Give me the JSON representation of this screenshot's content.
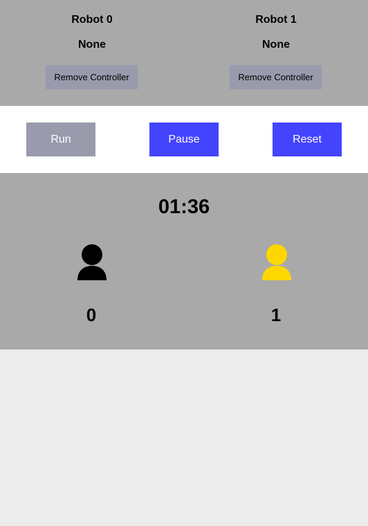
{
  "robots": [
    {
      "name": "Robot 0",
      "controller": "None",
      "remove_label": "Remove Controller"
    },
    {
      "name": "Robot 1",
      "controller": "None",
      "remove_label": "Remove Controller"
    }
  ],
  "controls": {
    "run_label": "Run",
    "pause_label": "Pause",
    "reset_label": "Reset"
  },
  "game": {
    "timer": "01:36",
    "players": [
      {
        "icon": "person-icon",
        "color": "#000000",
        "score": "0"
      },
      {
        "icon": "person-icon",
        "color": "#ffd700",
        "score": "1"
      }
    ]
  },
  "colors": {
    "panel_gray": "#a9a9a9",
    "button_disabled": "#9a9aad",
    "button_active": "#4444ff",
    "page_background": "#ececec"
  }
}
